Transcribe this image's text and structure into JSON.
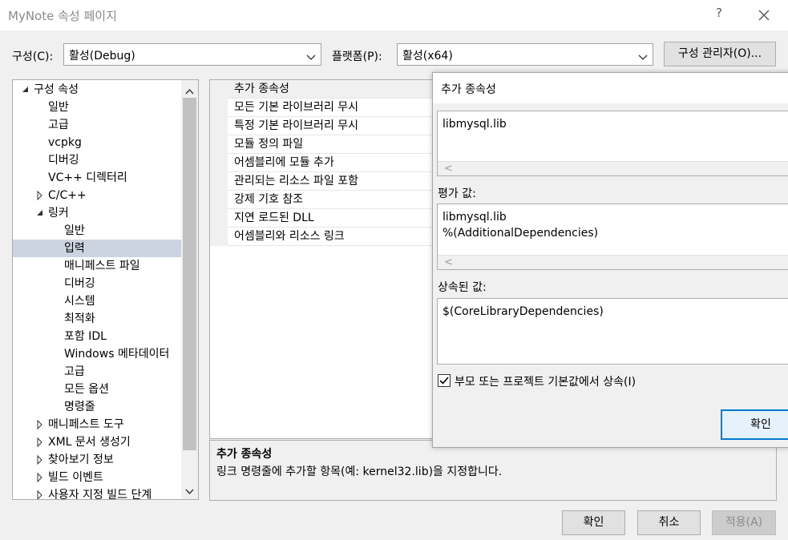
{
  "window": {
    "title": "MyNote 속성 페이지",
    "help_label": "?"
  },
  "config_row": {
    "config_label": "구성(C):",
    "config_value": "활성(Debug)",
    "platform_label": "플랫폼(P):",
    "platform_value": "활성(x64)",
    "manager_button": "구성 관리자(O)..."
  },
  "tree": {
    "items": [
      {
        "label": "구성 속성",
        "state": "expanded"
      },
      {
        "label": "일반"
      },
      {
        "label": "고급"
      },
      {
        "label": "vcpkg"
      },
      {
        "label": "디버깅"
      },
      {
        "label": "VC++ 디렉터리"
      },
      {
        "label": "C/C++",
        "state": "collapsed"
      },
      {
        "label": "링커",
        "state": "expanded"
      },
      {
        "label": "일반"
      },
      {
        "label": "입력",
        "selected": true
      },
      {
        "label": "매니페스트 파일"
      },
      {
        "label": "디버깅"
      },
      {
        "label": "시스템"
      },
      {
        "label": "최적화"
      },
      {
        "label": "포함 IDL"
      },
      {
        "label": "Windows 메타데이터"
      },
      {
        "label": "고급"
      },
      {
        "label": "모든 옵션"
      },
      {
        "label": "명령줄"
      },
      {
        "label": "매니페스트 도구",
        "state": "collapsed"
      },
      {
        "label": "XML 문서 생성기",
        "state": "collapsed"
      },
      {
        "label": "찾아보기 정보",
        "state": "collapsed"
      },
      {
        "label": "빌드 이벤트",
        "state": "collapsed"
      },
      {
        "label": "사용자 지정 빌드 단계",
        "state": "collapsed"
      }
    ]
  },
  "property_grid": {
    "rows": [
      "추가 종속성",
      "모든 기본 라이브러리 무시",
      "특정 기본 라이브러리 무시",
      "모듈 정의 파일",
      "어셈블리에 모듈 추가",
      "관리되는 리소스 파일 포함",
      "강제 기호 참조",
      "지연 로드된 DLL",
      "어셈블리와 리소스 링크"
    ]
  },
  "description": {
    "title": "추가 종속성",
    "text": "링크 명령줄에 추가할 항목(예: kernel32.lib)을 지정합니다."
  },
  "dialog": {
    "title": "추가 종속성",
    "edit_value": "libmysql.lib",
    "evaluated_label": "평가 값:",
    "evaluated_value": "libmysql.lib\n%(AdditionalDependencies)",
    "inherited_label": "상속된 값:",
    "inherited_value": "$(CoreLibraryDependencies)",
    "inherit_checkbox_label": "부모 또는 프로젝트 기본값에서 상속(I)",
    "inherit_checked": true,
    "ok_button": "확인"
  },
  "footer": {
    "ok_button": "확인",
    "cancel_button": "취소",
    "apply_button": "적용(A)"
  },
  "colors": {
    "selection": "#ccd4e1",
    "accent_border": "#0078d7",
    "disabled_text": "#8a8a8a"
  }
}
